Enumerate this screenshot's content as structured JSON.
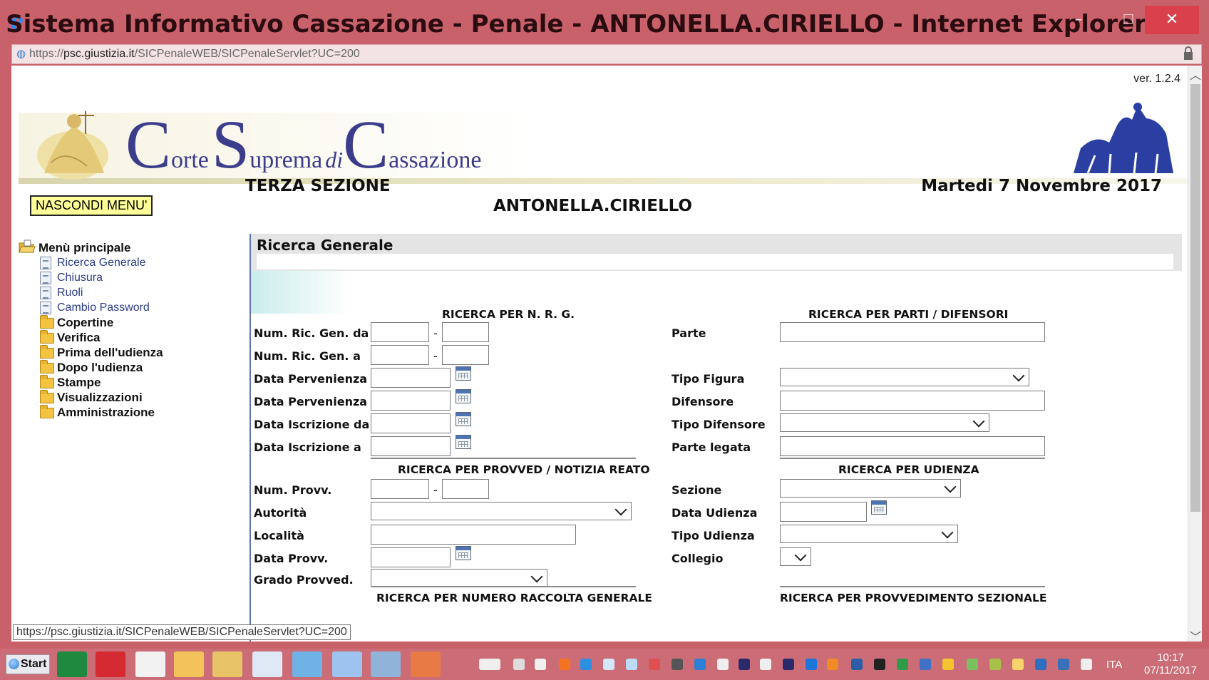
{
  "window": {
    "title": "Sistema Informativo Cassazione - Penale - ANTONELLA.CIRIELLO - Internet Explorer",
    "minimize": "–",
    "maximize": "☐",
    "close": "✕"
  },
  "address": {
    "scheme": "https://",
    "host": "psc.giustizia.it",
    "path": "/SICPenaleWEB/SICPenaleServlet?UC=200"
  },
  "page": {
    "version": "ver. 1.2.4",
    "logo": {
      "c1": "C",
      "w1": "orte",
      "s": "S",
      "w2": "uprema",
      "di": "di",
      "c2": "C",
      "w3": "assazione"
    },
    "section": "TERZA SEZIONE",
    "date": "Martedi 7 Novembre 2017",
    "user": "ANTONELLA.CIRIELLO",
    "toggle_menu": "NASCONDI MENU'"
  },
  "menu": {
    "root": "Menù principale",
    "leaves": [
      "Ricerca Generale",
      "Chiusura",
      "Ruoli",
      "Cambio Password"
    ],
    "folders": [
      "Copertine",
      "Verifica",
      "Prima dell'udienza",
      "Dopo l'udienza",
      "Stampe",
      "Visualizzazioni",
      "Amministrazione"
    ]
  },
  "panel": {
    "title": "Ricerca Generale",
    "nrg": {
      "heading": "RICERCA PER N. R. G.",
      "num_da": "Num. Ric. Gen. da",
      "num_a": "Num. Ric. Gen. a",
      "perv_da": "Data Pervenienza da",
      "perv_a": "Data Pervenienza a",
      "iscr_da": "Data Iscrizione da",
      "iscr_a": "Data Iscrizione a",
      "sep": "-"
    },
    "parti": {
      "heading": "RICERCA PER PARTI / DIFENSORI",
      "parte": "Parte",
      "tipo_figura": "Tipo Figura",
      "difensore": "Difensore",
      "tipo_difensore": "Tipo Difensore",
      "parte_legata": "Parte legata"
    },
    "provved": {
      "heading": "RICERCA PER PROVVED / NOTIZIA REATO",
      "num": "Num. Provv.",
      "autorita": "Autorità",
      "localita": "Località",
      "data": "Data Provv.",
      "grado": "Grado Provved.",
      "sep": "-"
    },
    "udienza": {
      "heading": "RICERCA PER UDIENZA",
      "sezione": "Sezione",
      "data": "Data Udienza",
      "tipo": "Tipo Udienza",
      "collegio": "Collegio"
    },
    "raccolta_heading": "RICERCA PER NUMERO RACCOLTA GENERALE",
    "sezionale_heading": "RICERCA PER PROVVEDIMENTO SEZIONALE"
  },
  "status_url": "https://psc.giustizia.it/SICPenaleWEB/SICPenaleServlet?UC=200",
  "taskbar": {
    "start": "Start",
    "lang": "ITA",
    "time": "10:17",
    "date": "07/11/2017"
  }
}
